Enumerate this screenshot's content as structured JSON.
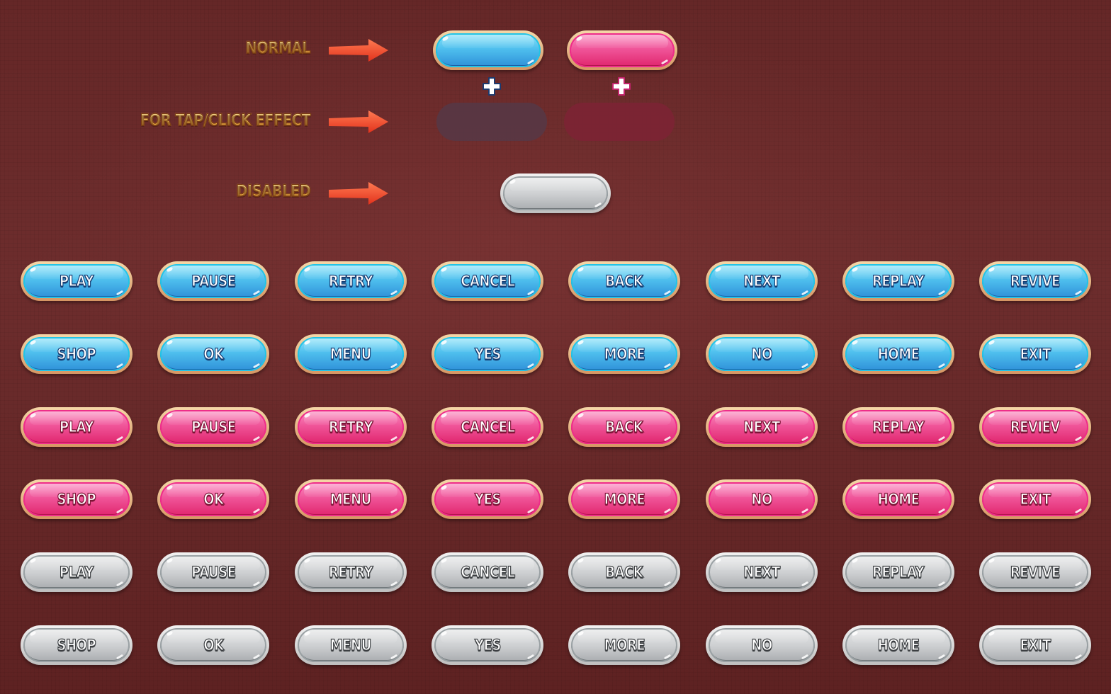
{
  "legend": {
    "normal_label": "NORMAL",
    "tap_label": "FOR TAP/CLICK EFFECT",
    "disabled_label": "DISABLED",
    "arrow_icon": "right-arrow-icon",
    "plus_icon": "plus-icon"
  },
  "colors": {
    "background": "#662a2a",
    "blue_button": "#4fc0ee",
    "pink_button": "#f0569a",
    "gray_button": "#cfd1d3",
    "button_rim": "#e8b886",
    "legend_text": "#f3b84e",
    "arrow": "#ef4a2e",
    "tap_overlay_blue": "#563847",
    "tap_overlay_pink": "#7c2434"
  },
  "rows": [
    {
      "variant": "blue",
      "labels": [
        "PLAY",
        "PAUSE",
        "RETRY",
        "CANCEL",
        "BACK",
        "NEXT",
        "REPLAY",
        "REVIVE"
      ]
    },
    {
      "variant": "blue",
      "labels": [
        "SHOP",
        "OK",
        "MENU",
        "YES",
        "MORE",
        "NO",
        "HOME",
        "EXIT"
      ]
    },
    {
      "variant": "pink",
      "labels": [
        "PLAY",
        "PAUSE",
        "RETRY",
        "CANCEL",
        "BACK",
        "NEXT",
        "REPLAY",
        "REVIEV"
      ]
    },
    {
      "variant": "pink",
      "labels": [
        "SHOP",
        "OK",
        "MENU",
        "YES",
        "MORE",
        "NO",
        "HOME",
        "EXIT"
      ]
    },
    {
      "variant": "gray",
      "labels": [
        "PLAY",
        "PAUSE",
        "RETRY",
        "CANCEL",
        "BACK",
        "NEXT",
        "REPLAY",
        "REVIVE"
      ]
    },
    {
      "variant": "gray",
      "labels": [
        "SHOP",
        "OK",
        "MENU",
        "YES",
        "MORE",
        "NO",
        "HOME",
        "EXIT"
      ]
    }
  ]
}
